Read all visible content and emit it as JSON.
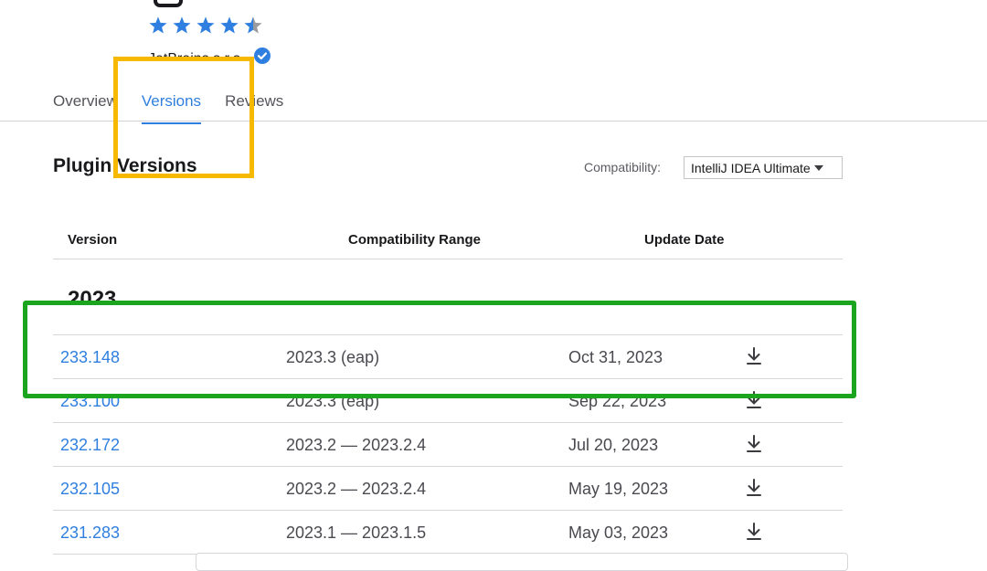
{
  "header": {
    "rating": 4.5,
    "rating_max": 5,
    "vendor": "JetBrains s.r.o.",
    "star_color": "#2f7fe0",
    "star_empty_color": "#9a9a9f"
  },
  "tabs": [
    {
      "label": "Overview",
      "active": false
    },
    {
      "label": "Versions",
      "active": true
    },
    {
      "label": "Reviews",
      "active": false
    }
  ],
  "section": {
    "title": "Plugin Versions",
    "compat_label": "Compatibility:",
    "compat_value": "IntelliJ IDEA Ultimate"
  },
  "table": {
    "headers": {
      "version": "Version",
      "range": "Compatibility Range",
      "date": "Update Date"
    },
    "year": "2023",
    "rows": [
      {
        "version": "233.148",
        "range": "2023.3 (eap)",
        "date": "Oct 31, 2023"
      },
      {
        "version": "233.100",
        "range": "2023.3 (eap)",
        "date": "Sep 22, 2023"
      },
      {
        "version": "232.172",
        "range": "2023.2 — 2023.2.4",
        "date": "Jul 20, 2023"
      },
      {
        "version": "232.105",
        "range": "2023.2 — 2023.2.4",
        "date": "May 19, 2023"
      },
      {
        "version": "231.283",
        "range": "2023.1 — 2023.1.5",
        "date": "May 03, 2023"
      }
    ]
  },
  "colors": {
    "accent": "#2f7fe0",
    "highlight_yellow": "#f7b900",
    "highlight_green": "#1ba41e"
  }
}
